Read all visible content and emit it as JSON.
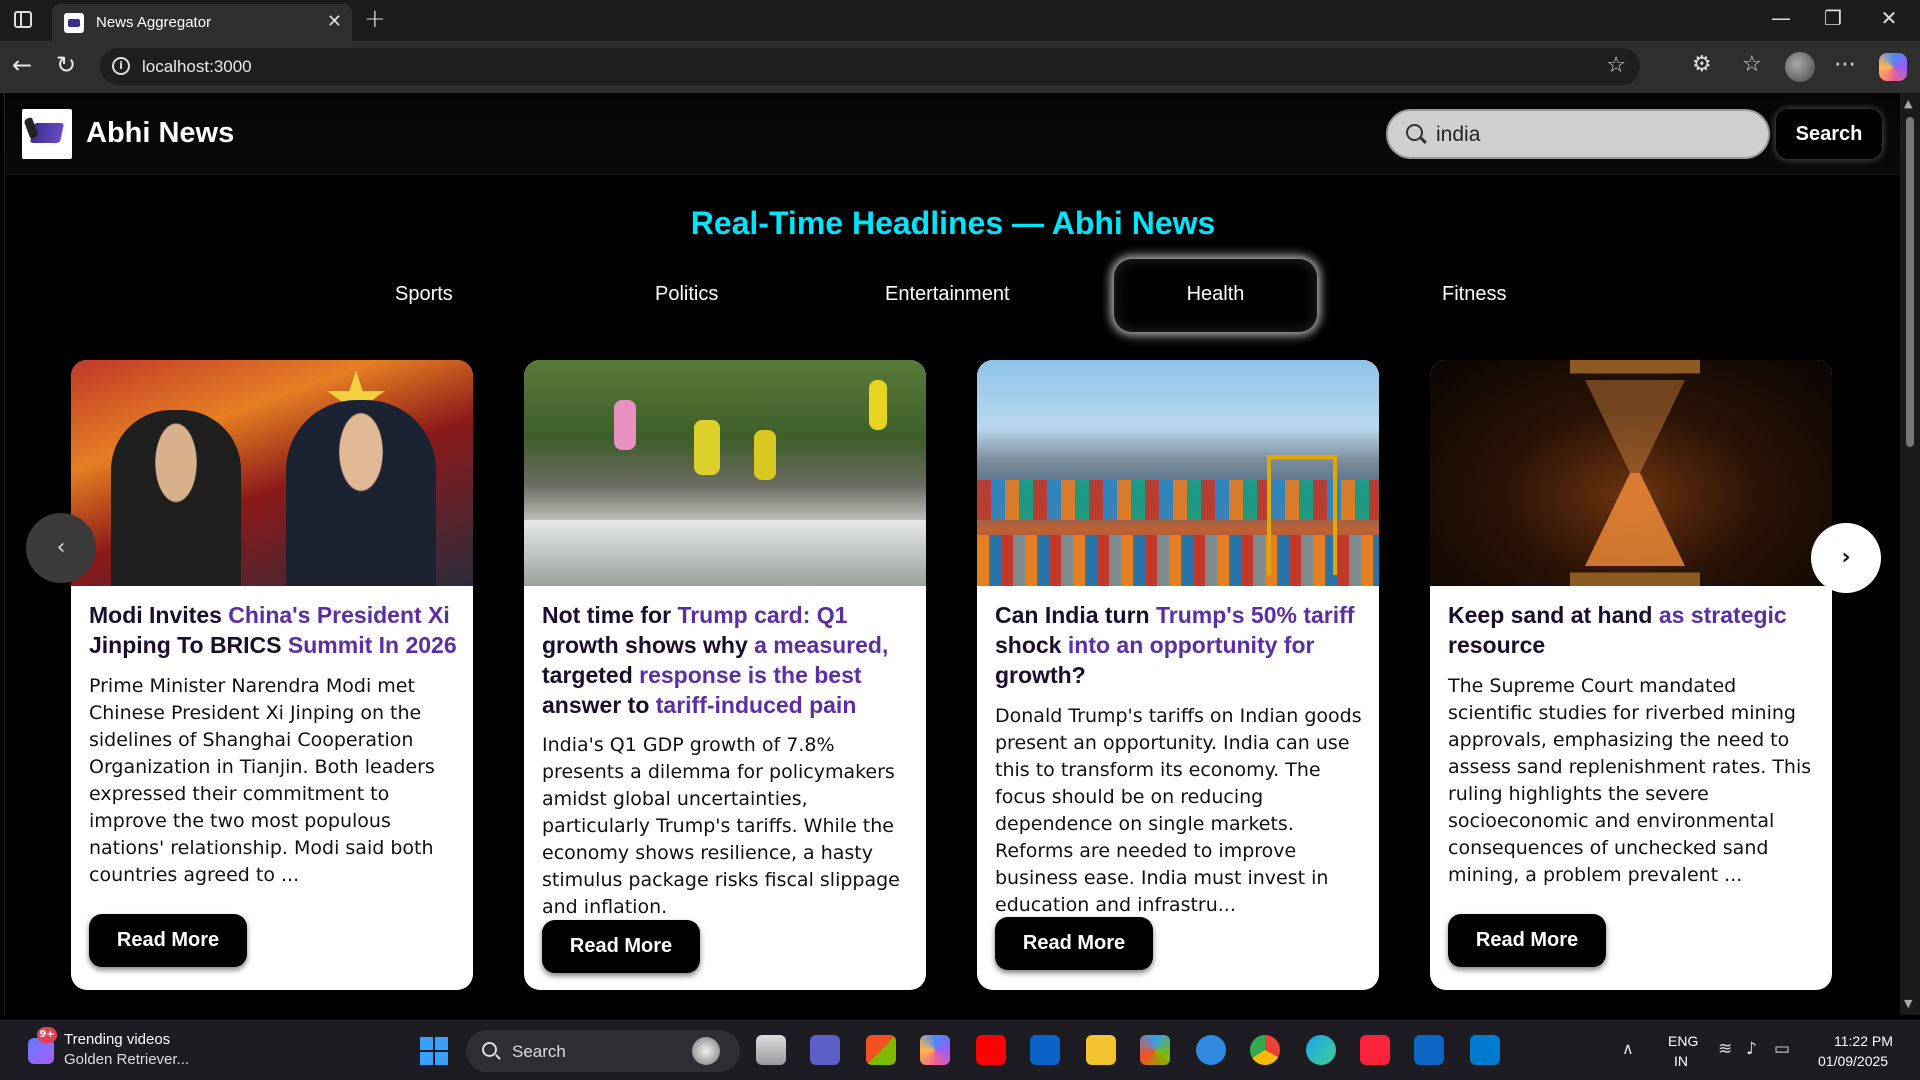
{
  "browser": {
    "tab_title": "News Aggregator",
    "url": "localhost:3000"
  },
  "header": {
    "brand": "Abhi News",
    "search_value": "india",
    "search_button": "Search"
  },
  "headline": "Real-Time Headlines — Abhi News",
  "categories": [
    "Sports",
    "Politics",
    "Entertainment",
    "Health",
    "Fitness"
  ],
  "active_category": "Health",
  "cards": [
    {
      "title_parts": [
        {
          "text": "Modi Invites ",
          "hl": false
        },
        {
          "text": "China's President Xi",
          "hl": true
        },
        {
          "text": " Jinping To BRICS ",
          "hl": false
        },
        {
          "text": "Summit In 2026",
          "hl": true
        }
      ],
      "description": "Prime Minister Narendra Modi met Chinese President Xi Jinping on the sidelines of Shanghai Cooperation Organization in Tianjin. Both leaders expressed their commitment to improve the two most populous nations' relationship. Modi said both countries agreed to ...",
      "button": "Read More"
    },
    {
      "title_parts": [
        {
          "text": "Not time for ",
          "hl": false
        },
        {
          "text": "Trump card: Q1",
          "hl": true
        },
        {
          "text": " growth shows why ",
          "hl": false
        },
        {
          "text": "a measured,",
          "hl": true
        },
        {
          "text": " targeted ",
          "hl": false
        },
        {
          "text": "response is the best",
          "hl": true
        },
        {
          "text": " answer to ",
          "hl": false
        },
        {
          "text": "tariff-induced pain",
          "hl": true
        }
      ],
      "description": "India's Q1 GDP growth of 7.8% presents a dilemma for policymakers amidst global uncertainties, particularly Trump's tariffs. While the economy shows resilience, a hasty stimulus package risks fiscal slippage and inflation.",
      "button": "Read More"
    },
    {
      "title_parts": [
        {
          "text": "Can India turn ",
          "hl": false
        },
        {
          "text": "Trump's 50% tariff",
          "hl": true
        },
        {
          "text": " shock ",
          "hl": false
        },
        {
          "text": "into an opportunity for",
          "hl": true
        },
        {
          "text": " growth?",
          "hl": false
        }
      ],
      "description": "Donald Trump's tariffs on Indian goods present an opportunity. India can use this to transform its economy. The focus should be on reducing dependence on single markets. Reforms are needed to improve business ease. India must invest in education and infrastru...",
      "button": "Read More"
    },
    {
      "title_parts": [
        {
          "text": "Keep sand at hand",
          "hl": false
        },
        {
          "text": " as strategic",
          "hl": true
        },
        {
          "text": " resource",
          "hl": false
        }
      ],
      "description": "The Supreme Court mandated scientific studies for riverbed mining approvals, emphasizing the need to assess sand replenishment rates. This ruling highlights the severe socioeconomic and environmental consequences of unchecked sand mining, a problem prevalent ...",
      "button": "Read More"
    }
  ],
  "taskbar": {
    "widget_line1": "Trending videos",
    "widget_line2": "Golden Retriever...",
    "widget_badge": "9+",
    "search_label": "Search",
    "lang_line1": "ENG",
    "lang_line2": "IN",
    "time": "11:22 PM",
    "date": "01/09/2025"
  },
  "icons": {
    "prev": "chevron-left-icon",
    "next": "chevron-right-icon"
  },
  "colors": {
    "headline": "#00e5ff",
    "title_highlight": "#5b2ea6",
    "title_text": "#1a0d2e"
  }
}
